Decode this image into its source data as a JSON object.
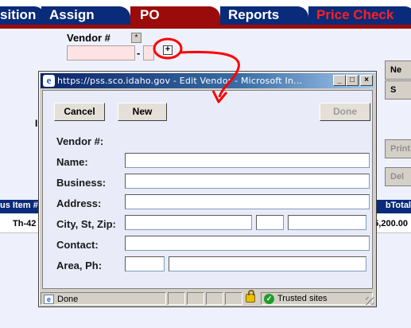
{
  "tabs": {
    "position": "sition",
    "assign": "Assign",
    "po": "PO",
    "reports": "Reports",
    "price_check": "Price Check"
  },
  "vendor_header": {
    "label": "Vendor #",
    "star_label": "*",
    "dash": "-",
    "plus_label": "+"
  },
  "right_buttons": {
    "new": "Ne",
    "second": "S",
    "print": "Print",
    "delete": "Del"
  },
  "grid": {
    "header_left": "us Item #",
    "header_right": "bTotal",
    "row_left": "Th-42",
    "row_right": "5,200.00"
  },
  "popup": {
    "title": "https://pss.sco.idaho.gov - Edit Vendor - Microsoft In...",
    "buttons": {
      "cancel": "Cancel",
      "new": "New",
      "done": "Done"
    },
    "labels": {
      "vendor_no": "Vendor #:",
      "name": "Name:",
      "business": "Business:",
      "address": "Address:",
      "city_st_zip": "City, St, Zip:",
      "contact": "Contact:",
      "area_ph": "Area, Ph:"
    },
    "fields": {
      "name": "",
      "business": "",
      "address": "",
      "city": "",
      "state": "",
      "zip": "",
      "contact": "",
      "area_code": "",
      "phone": ""
    },
    "statusbar": {
      "status": "Done",
      "zone": "Trusted sites"
    }
  },
  "colors": {
    "tab_blue": "#0a2a7a",
    "tab_red": "#9b0b0b",
    "price_check_text": "#ff2020",
    "annotation": "#ff0000"
  }
}
